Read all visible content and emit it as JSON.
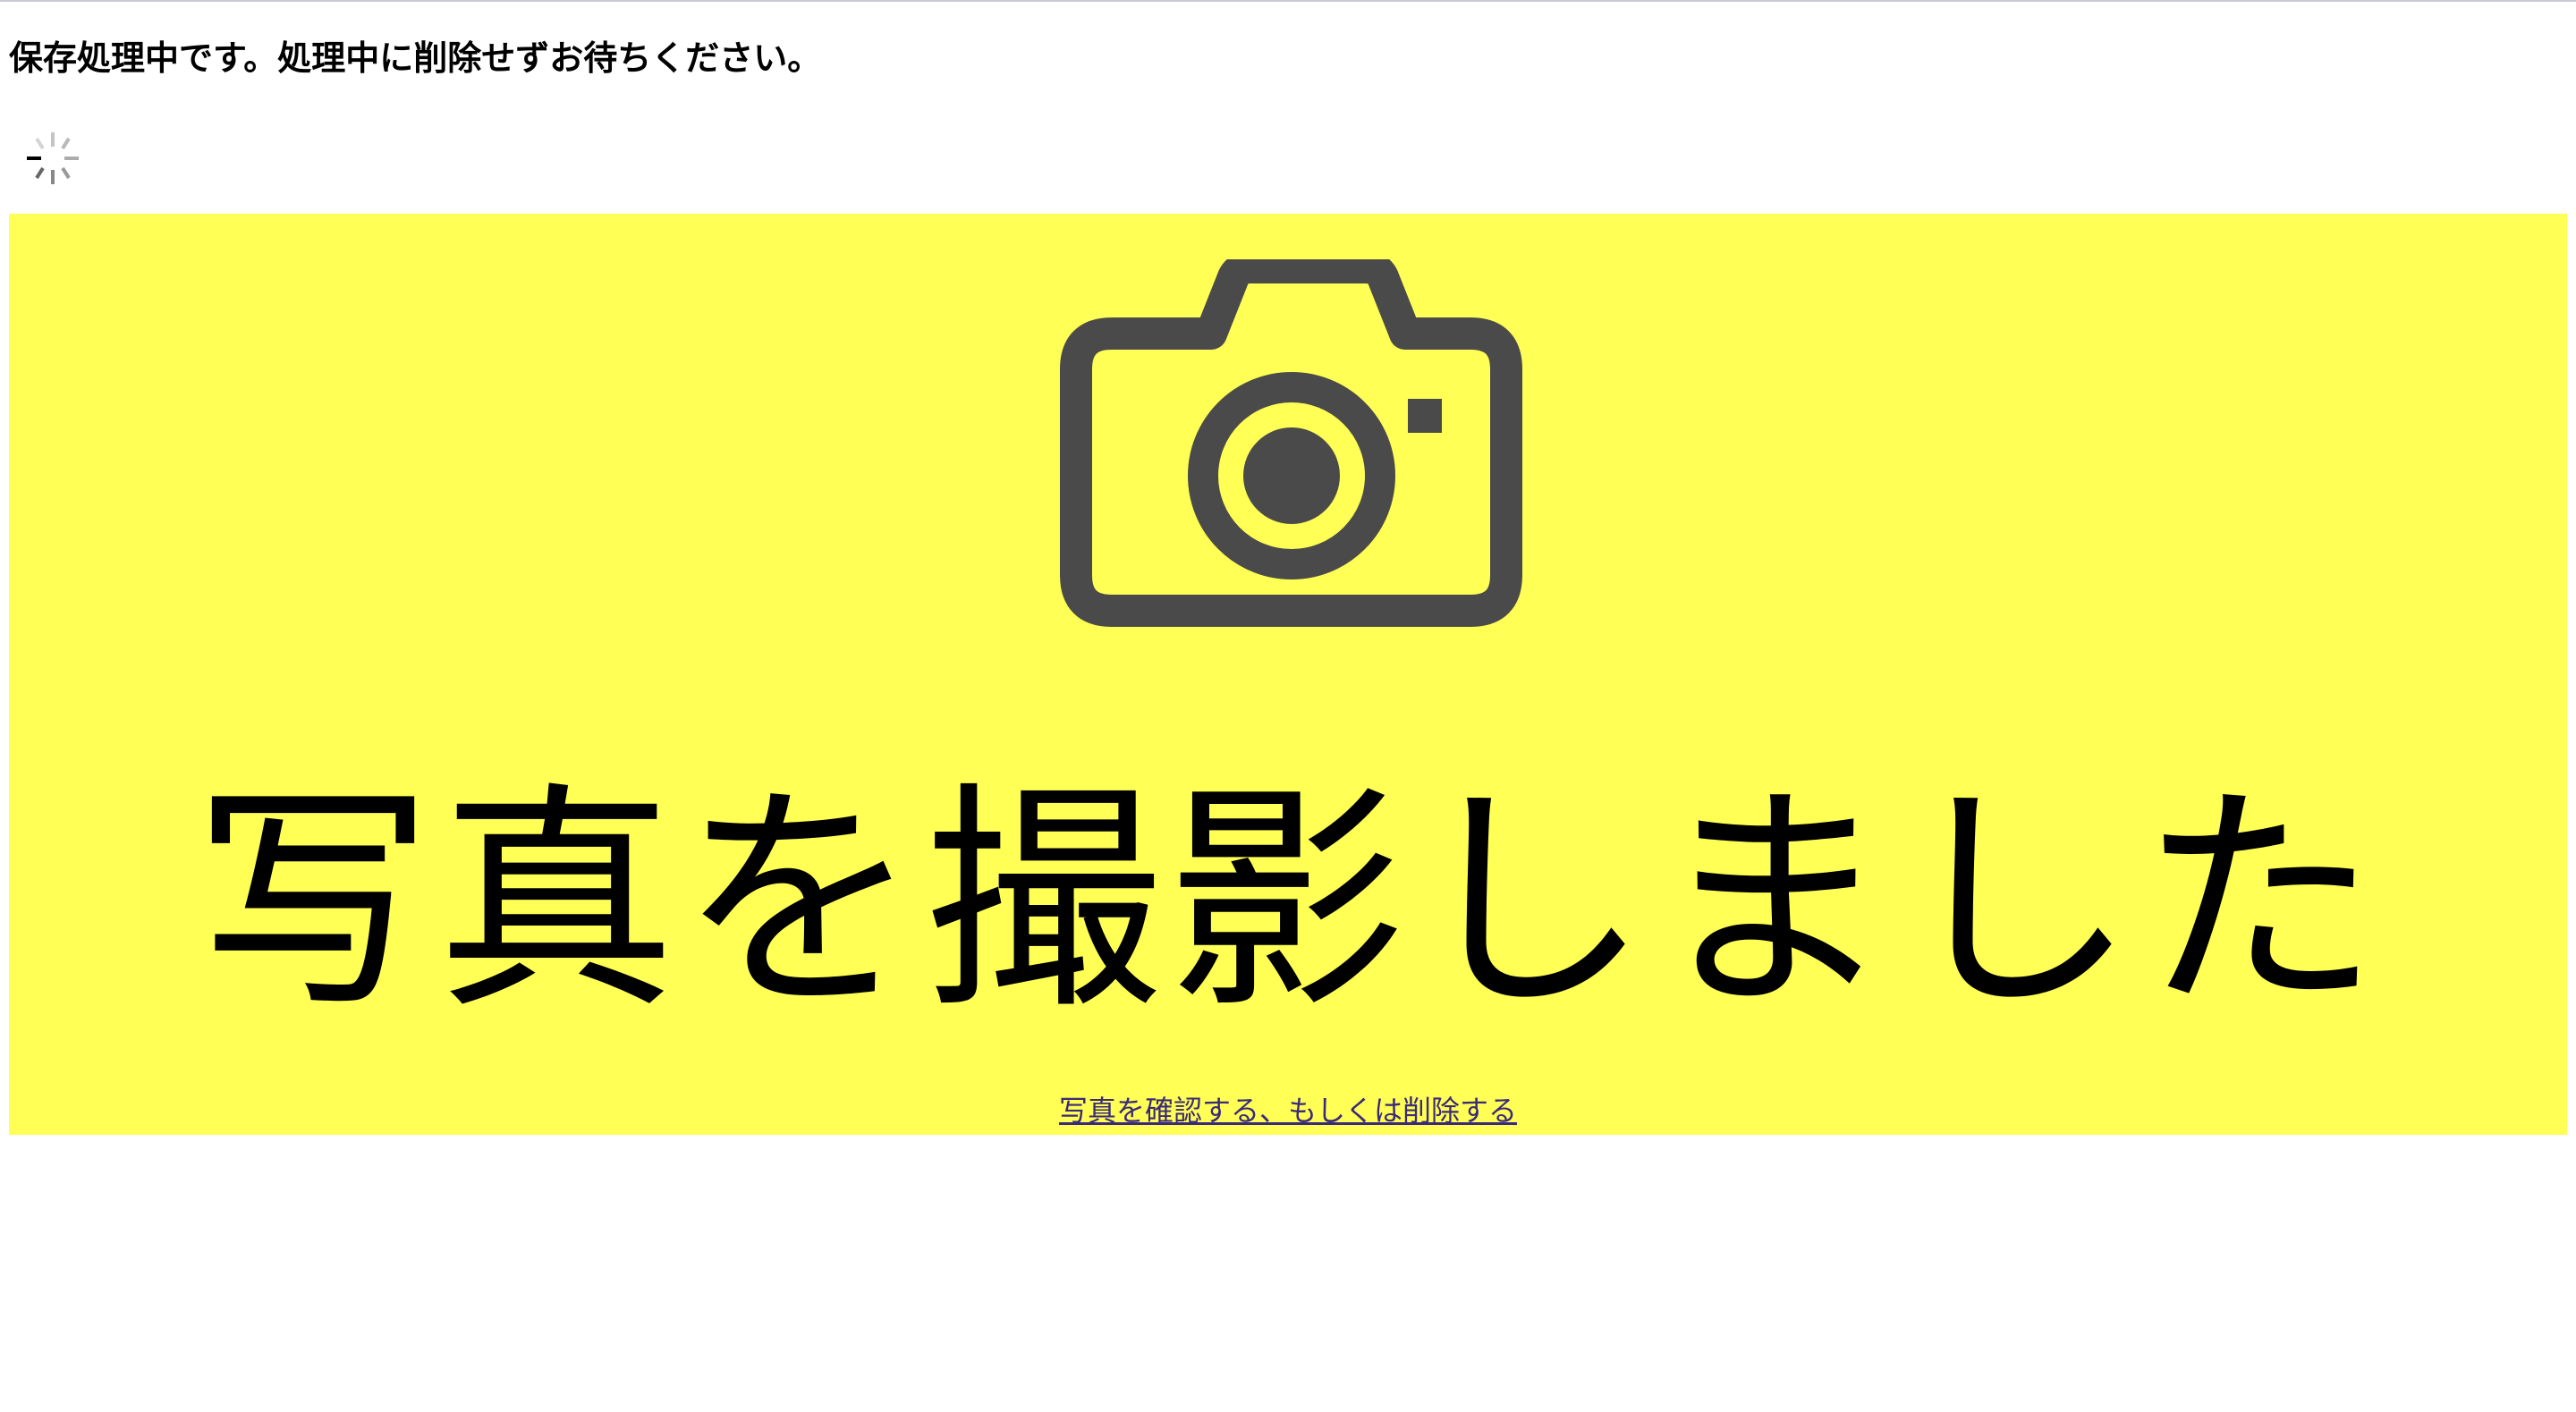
{
  "status": {
    "message": "保存処理中です。処理中に削除せずお待ちください。",
    "spinner_icon": "loading-spinner-icon"
  },
  "banner": {
    "background_color": "#ffff55",
    "icon": "camera-icon",
    "icon_color": "#4a4a4a",
    "headline": "写真を撮影しました",
    "link_label": "写真を確認する、もしくは削除する"
  }
}
